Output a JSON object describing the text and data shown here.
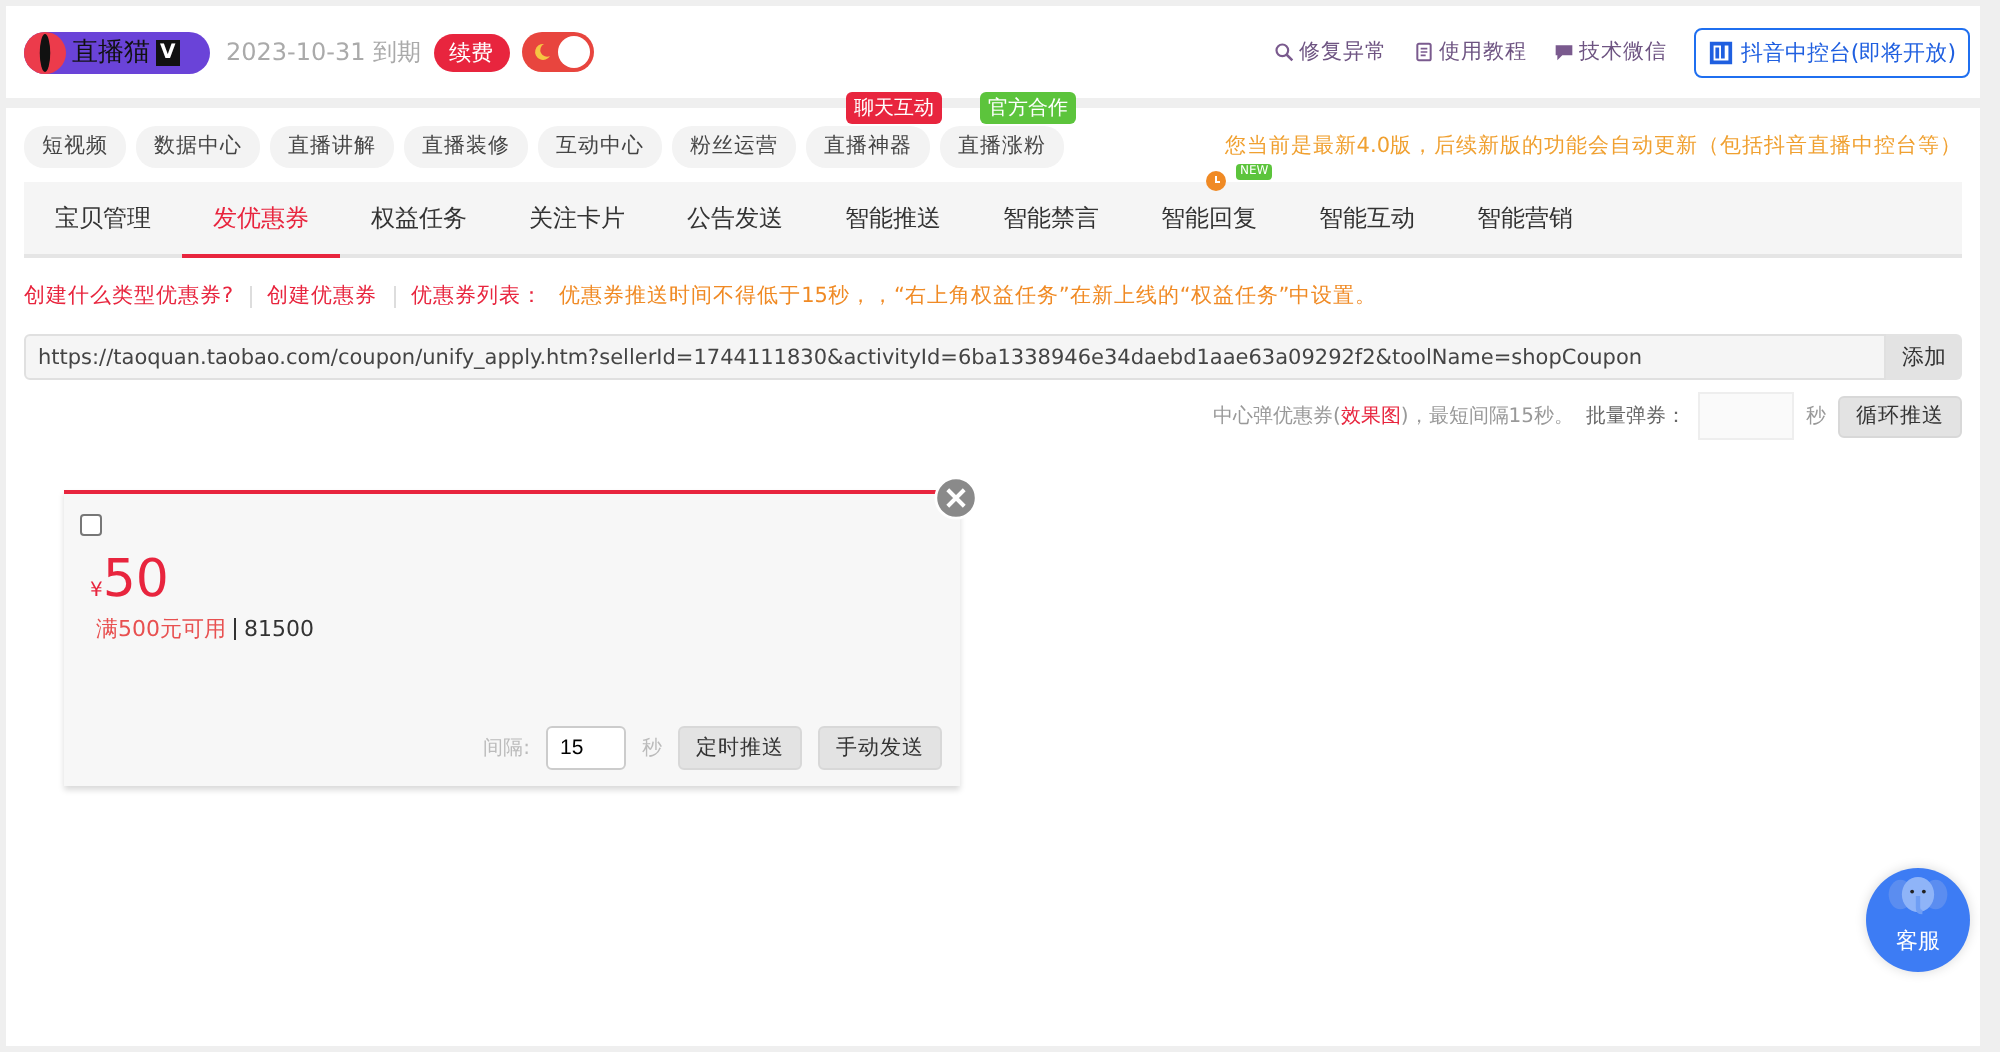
{
  "header": {
    "logo_text": "直播猫",
    "logo_badge": "V",
    "expiry": "2023-10-31 到期",
    "renew": "续费",
    "night_mode": true,
    "links": [
      {
        "kind": "repair",
        "label": "修复异常"
      },
      {
        "kind": "book",
        "label": "使用教程"
      },
      {
        "kind": "chat",
        "label": "技术微信"
      }
    ],
    "console_button": "抖音中控台(即将开放)"
  },
  "nav": [
    {
      "label": "短视频"
    },
    {
      "label": "数据中心"
    },
    {
      "label": "直播讲解"
    },
    {
      "label": "直播装修"
    },
    {
      "label": "互动中心"
    },
    {
      "label": "粉丝运营"
    },
    {
      "label": "直播神器",
      "badge": "聊天互动",
      "color": "#e8253e"
    },
    {
      "label": "直播涨粉",
      "badge": "官方合作",
      "color": "#5cc43c"
    }
  ],
  "notice": "您当前是最新4.0版，后续新版的功能会自动更新（包括抖音直播中控台等）",
  "tabs": [
    {
      "label": "宝贝管理",
      "selected": false
    },
    {
      "label": "发优惠券",
      "selected": true
    },
    {
      "label": "权益任务",
      "selected": false
    },
    {
      "label": "关注卡片",
      "selected": false
    },
    {
      "label": "公告发送",
      "selected": false
    },
    {
      "label": "智能推送",
      "selected": false
    },
    {
      "label": "智能禁言",
      "selected": false
    },
    {
      "label": "智能回复",
      "selected": false,
      "clock": true,
      "new_badge": "NEW"
    },
    {
      "label": "智能互动",
      "selected": false
    },
    {
      "label": "智能营销",
      "selected": false
    }
  ],
  "help_links": [
    "创建什么类型优惠券?",
    "创建优惠券",
    "优惠券列表："
  ],
  "tip": "优惠券推送时间不得低于15秒，，“右上角权益任务”在新上线的“权益任务”中设置。",
  "url_field": {
    "value": "https://taoquan.taobao.com/coupon/unify_apply.htm?sellerId=1744111830&activityId=6ba1338946e34daebd1aae63a09292f2&toolName=shopCoupon",
    "button": "添加"
  },
  "batch": {
    "text": "中心弹优惠券(**效果图**)，最短间隔15秒。",
    "label": "批量弹券：",
    "unit": "秒",
    "button": "循环推送"
  },
  "coupons": [
    {
      "checked": false,
      "currency": "¥",
      "amount": "50",
      "condition": "满500元可用",
      "count": "81500",
      "interval_label": "间隔:",
      "interval": "15",
      "unit": "秒",
      "buttons": [
        "定时推送",
        "手动发送"
      ]
    }
  ],
  "service": "客服"
}
